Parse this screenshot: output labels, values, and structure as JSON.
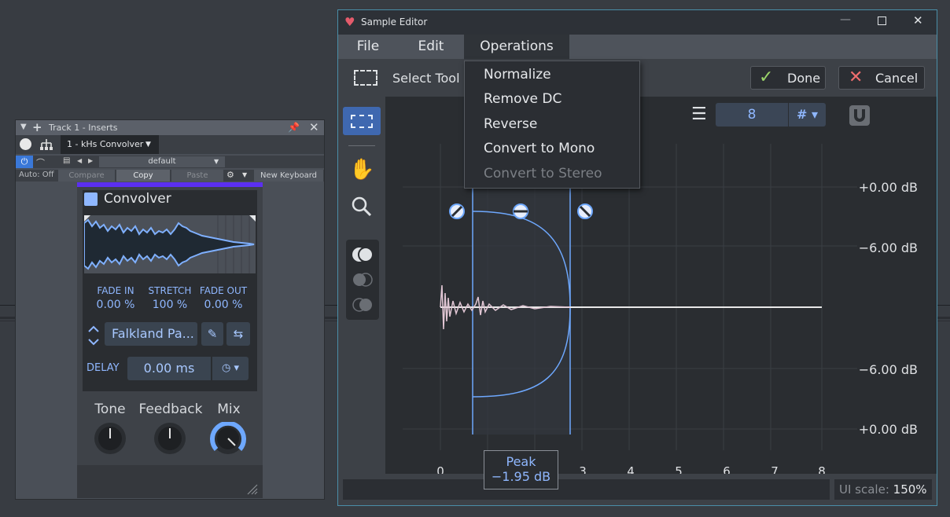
{
  "inserts": {
    "title": "Track 1 - Inserts",
    "insert_name": "1 - kHs Convolver",
    "preset": "default",
    "auto_label": "Auto: Off",
    "compare_label": "Compare",
    "copy_label": "Copy",
    "paste_label": "Paste",
    "keyboard_label": "New Keyboard"
  },
  "convolver": {
    "title": "Convolver",
    "fade_in_label": "FADE IN",
    "fade_in_value": "0.00 %",
    "stretch_label": "STRETCH",
    "stretch_value": "100 %",
    "fade_out_label": "FADE OUT",
    "fade_out_value": "0.00 %",
    "ir_name": "Falkland Pa...",
    "delay_label": "DELAY",
    "delay_value": "0.00 ms",
    "tone_label": "Tone",
    "feedback_label": "Feedback",
    "mix_label": "Mix",
    "tone_level": 0.5,
    "feedback_level": 0.5,
    "mix_level": 0.85,
    "accent_color": "#5b2ff0"
  },
  "editor": {
    "title": "Sample Editor",
    "menu": [
      "File",
      "Edit",
      "Operations"
    ],
    "tool_label": "Select Tool",
    "done_label": "Done",
    "cancel_label": "Cancel",
    "grid_value": "8",
    "db_labels": [
      "+0.00 dB",
      "−6.00 dB",
      "−6.00 dB",
      "+0.00 dB"
    ],
    "x_ticks": [
      "0",
      "3",
      "4",
      "5",
      "6",
      "7",
      "8"
    ],
    "peak_label": "Peak",
    "peak_value": "−1.95 dB",
    "ui_scale_label": "UI scale:",
    "ui_scale_value": "150%",
    "accent_color": "#6ea8fe"
  },
  "operations_menu": [
    {
      "label": "Normalize",
      "enabled": true
    },
    {
      "label": "Remove DC",
      "enabled": true
    },
    {
      "label": "Reverse",
      "enabled": true
    },
    {
      "label": "Convert to Mono",
      "enabled": true
    },
    {
      "label": "Convert to Stereo",
      "enabled": false
    }
  ]
}
